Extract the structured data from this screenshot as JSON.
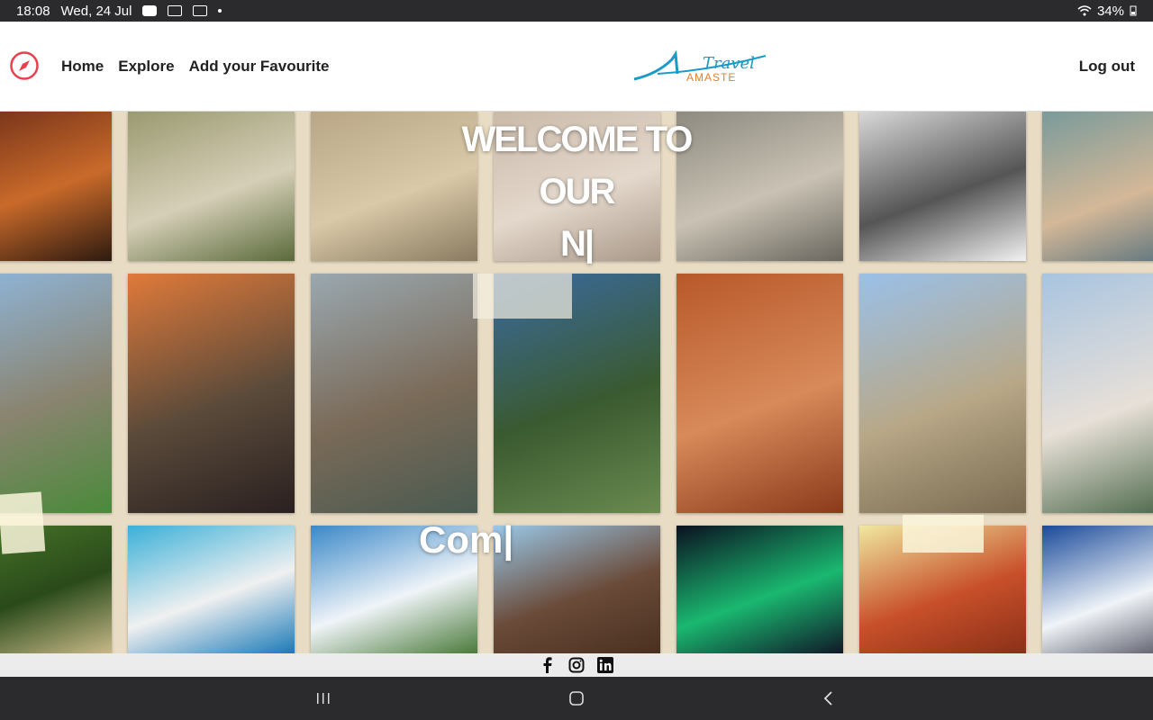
{
  "status": {
    "time": "18:08",
    "date": "Wed, 24 Jul",
    "battery": "34%"
  },
  "nav": {
    "links": [
      "Home",
      "Explore",
      "Add your Favourite"
    ],
    "logout": "Log out",
    "logo_top": "Travel",
    "logo_bottom": "AMASTE"
  },
  "hero": {
    "welcome_lines": [
      "WELCOME TO",
      "OUR",
      "N|"
    ],
    "typed": "Com|"
  },
  "footer": {
    "social_icons": [
      "facebook-icon",
      "instagram-icon",
      "linkedin-icon"
    ]
  },
  "colors": {
    "accent": "#e8414d",
    "logo_blue": "#1b9ac7",
    "logo_orange": "#e87d2a",
    "hero_bg": "#e8dcc4"
  },
  "tiles": [
    {
      "name": "tile-city-night",
      "colors": [
        "#6b2c18",
        "#c96a2a",
        "#2d1a10"
      ]
    },
    {
      "name": "tile-ruins-garden",
      "colors": [
        "#9a9a70",
        "#d6cfb8",
        "#5a6a3a"
      ]
    },
    {
      "name": "tile-ephesus-library",
      "colors": [
        "#b8a686",
        "#d9c9a8",
        "#8a7a60"
      ]
    },
    {
      "name": "tile-statue-drape",
      "colors": [
        "#c9b9a8",
        "#e4d8cc",
        "#a89888"
      ]
    },
    {
      "name": "tile-amphitheatre",
      "colors": [
        "#8e8a80",
        "#c9c2b4",
        "#6a665e"
      ]
    },
    {
      "name": "tile-colossus-engraving",
      "colors": [
        "#d8d8d8",
        "#555555",
        "#f2f2f2"
      ]
    },
    {
      "name": "tile-old-map",
      "colors": [
        "#7a9a9a",
        "#d4b898",
        "#4a6a7a"
      ]
    },
    {
      "name": "tile-chichen-itza",
      "colors": [
        "#8fb8e0",
        "#8a8470",
        "#4a8a3a"
      ]
    },
    {
      "name": "tile-christ-redeemer",
      "colors": [
        "#e07a3a",
        "#5a4a3a",
        "#2a2020"
      ]
    },
    {
      "name": "tile-great-wall",
      "colors": [
        "#9aa8b0",
        "#7a6a58",
        "#4a5a50"
      ]
    },
    {
      "name": "tile-machu-picchu",
      "colors": [
        "#3a6aa0",
        "#3a5a30",
        "#6a8a50"
      ]
    },
    {
      "name": "tile-petra",
      "colors": [
        "#b8582a",
        "#d88a5a",
        "#8a3a1a"
      ]
    },
    {
      "name": "tile-colosseum",
      "colors": [
        "#9ac0e8",
        "#b8a888",
        "#7a6a50"
      ]
    },
    {
      "name": "tile-taj-mahal",
      "colors": [
        "#a8c4e0",
        "#e8e0d8",
        "#3a5a3a"
      ]
    },
    {
      "name": "tile-river-forest",
      "colors": [
        "#4a7a2a",
        "#2a4a1a",
        "#c8b888"
      ]
    },
    {
      "name": "tile-reef",
      "colors": [
        "#3ab0d8",
        "#f0f0f0",
        "#1a7ab8"
      ]
    },
    {
      "name": "tile-waterfall",
      "colors": [
        "#3a88c8",
        "#f0f4f8",
        "#4a7a3a"
      ]
    },
    {
      "name": "tile-volcano",
      "colors": [
        "#9ac8e8",
        "#6a4a38",
        "#4a3020"
      ]
    },
    {
      "name": "tile-aurora",
      "colors": [
        "#0a1020",
        "#1ab870",
        "#101828"
      ]
    },
    {
      "name": "tile-grand-canyon",
      "colors": [
        "#f0e8a0",
        "#c8502a",
        "#8a3018"
      ]
    },
    {
      "name": "tile-everest",
      "colors": [
        "#1a4a9a",
        "#f0f4f8",
        "#3a3a4a"
      ]
    }
  ]
}
